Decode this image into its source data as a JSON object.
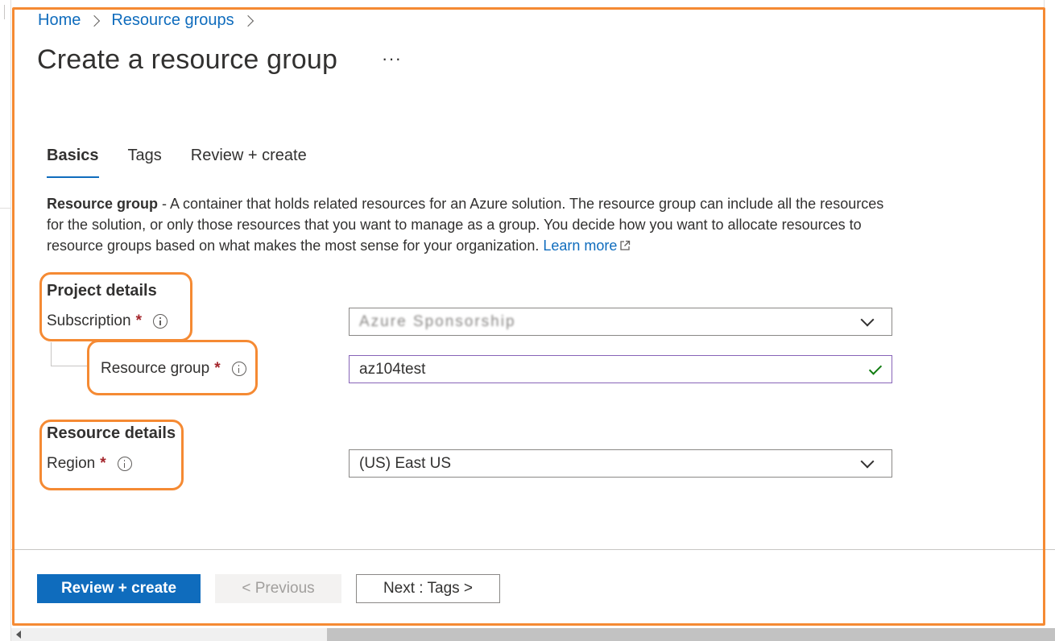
{
  "breadcrumb": {
    "items": [
      "Home",
      "Resource groups"
    ]
  },
  "page": {
    "title": "Create a resource group",
    "more_label": "···"
  },
  "tabs": [
    {
      "label": "Basics",
      "active": true
    },
    {
      "label": "Tags",
      "active": false
    },
    {
      "label": "Review + create",
      "active": false
    }
  ],
  "description": {
    "bold": "Resource group",
    "text": " - A container that holds related resources for an Azure solution. The resource group can include all the resources for the solution, or only those resources that you want to manage as a group. You decide how you want to allocate resources to resource groups based on what makes the most sense for your organization. ",
    "learn_more": "Learn more"
  },
  "project_details": {
    "heading": "Project details",
    "subscription_label": "Subscription",
    "subscription_value": "Azure Sponsorship",
    "resource_group_label": "Resource group",
    "resource_group_value": "az104test"
  },
  "resource_details": {
    "heading": "Resource details",
    "region_label": "Region",
    "region_value": "(US) East US"
  },
  "required_marker": "*",
  "footer": {
    "review_create_label": "Review + create",
    "previous_label": "< Previous",
    "next_label": "Next : Tags >"
  },
  "colors": {
    "accent": "#0f6cbd",
    "annotation": "#f58a33",
    "required": "#a4262c",
    "valid_check": "#107c10"
  }
}
